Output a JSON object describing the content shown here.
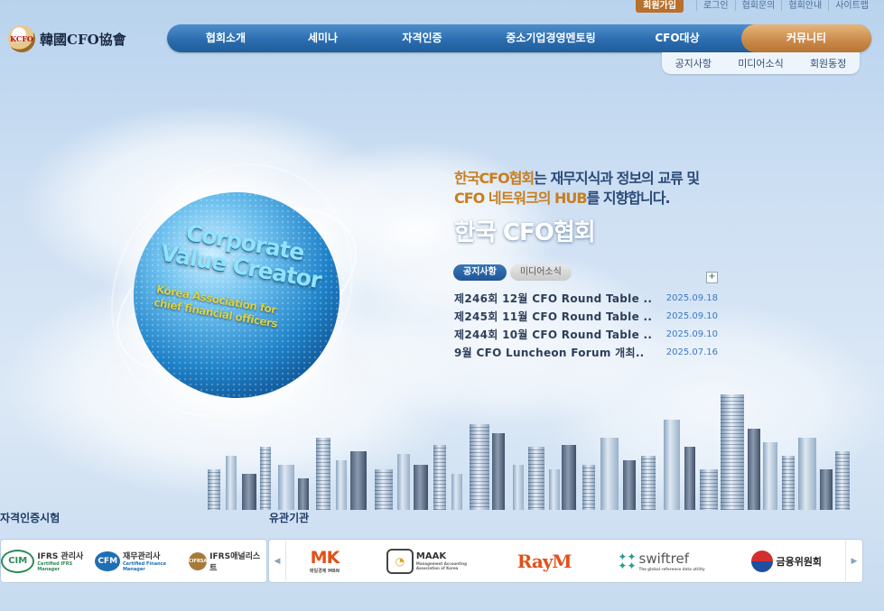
{
  "util": {
    "join": "회원가입",
    "links": [
      "로그인",
      "협회문의",
      "협회안내",
      "사이트맵"
    ]
  },
  "logo": {
    "emblem": "KCFO",
    "name": "韓國CFO協會"
  },
  "nav": {
    "items": [
      "협회소개",
      "세미나",
      "자격인증",
      "중소기업경영멘토링",
      "CFO대상"
    ],
    "active": "커뮤니티",
    "sub": [
      "공지사항",
      "미디어소식",
      "회원동정"
    ]
  },
  "hero": {
    "globe_line1": "Corporate",
    "globe_line2": "Value Creator",
    "globe_sub1": "Korea Association for",
    "globe_sub2": "chief financial officers",
    "slogan_l1_hl": "한국CFO협회",
    "slogan_l1": "는 재무지식과 정보의 교류 및",
    "slogan_l2_hl": "CFO 네트워크의 HUB",
    "slogan_l2": "를 지향합니다.",
    "slogan_l3": "한국 CFO협회"
  },
  "news": {
    "tab_on": "공지사항",
    "tab_off": "미디어소식",
    "more": "+",
    "items": [
      {
        "title": "제246회 12월 CFO Round Table ..",
        "date": "2025.09.18"
      },
      {
        "title": "제245회 11월 CFO Round Table ..",
        "date": "2025.09.10"
      },
      {
        "title": "제244회 10월 CFO Round Table ..",
        "date": "2025.09.10"
      },
      {
        "title": "9월 CFO Luncheon Forum 개최..",
        "date": "2025.07.16"
      }
    ]
  },
  "cert": {
    "heading": "자격인증시험",
    "logos": [
      {
        "mark": "CIM",
        "name": "IFRS 관리사",
        "sub": "Certified IFRS Manager"
      },
      {
        "mark": "CFM",
        "name": "재무관리사",
        "sub": "Certified Finance Manager"
      },
      {
        "mark": "CIFRSA",
        "name": "IFRS애널리스트",
        "sub": ""
      }
    ]
  },
  "related": {
    "heading": "유관기관",
    "prev": "◀",
    "next": "▶",
    "logos": [
      {
        "mark": "MK",
        "sub": "매일경제 MBN"
      },
      {
        "mark": "MAAK",
        "sub": "Management Accounting Association of Korea"
      },
      {
        "mark": "RayM",
        "sub": ""
      },
      {
        "mark": "swiftref",
        "sub": "The global reference data utility"
      },
      {
        "mark": "금융위원회",
        "sub": ""
      }
    ]
  },
  "colors": {
    "nav_blue": "#2b6db0",
    "nav_active": "#c9894a",
    "highlight": "#c97e1e",
    "date_blue": "#3d78c4"
  }
}
